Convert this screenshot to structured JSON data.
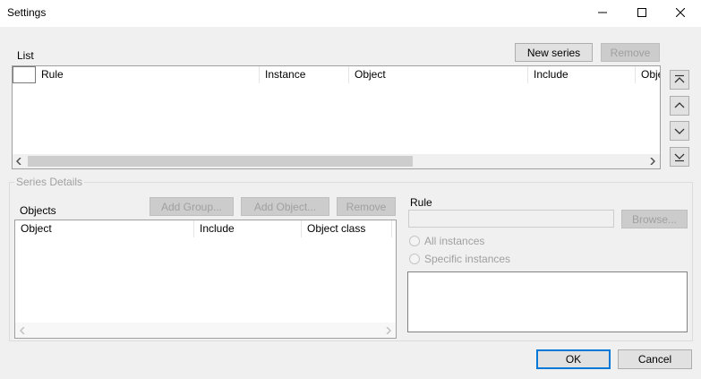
{
  "window": {
    "title": "Settings"
  },
  "list": {
    "label": "List",
    "new_series_label": "New series",
    "remove_label": "Remove",
    "columns": [
      "Rule",
      "Instance",
      "Object",
      "Include",
      "Obje"
    ]
  },
  "series_details": {
    "label": "Series Details",
    "objects": {
      "label": "Objects",
      "add_group_label": "Add Group...",
      "add_object_label": "Add Object...",
      "remove_label": "Remove",
      "columns": [
        "Object",
        "Include",
        "Object class"
      ]
    },
    "rule": {
      "label": "Rule",
      "value": "",
      "browse_label": "Browse...",
      "all_instances_label": "All instances",
      "specific_instances_label": "Specific instances"
    }
  },
  "footer": {
    "ok_label": "OK",
    "cancel_label": "Cancel"
  },
  "icons": {
    "minimize": "minimize-icon",
    "maximize": "maximize-icon",
    "close": "close-icon",
    "move_top": "move-top-icon",
    "move_up": "move-up-icon",
    "move_down": "move-down-icon",
    "move_bottom": "move-bottom-icon"
  },
  "colors": {
    "accent": "#0078d7",
    "background": "#f0f0f0"
  }
}
